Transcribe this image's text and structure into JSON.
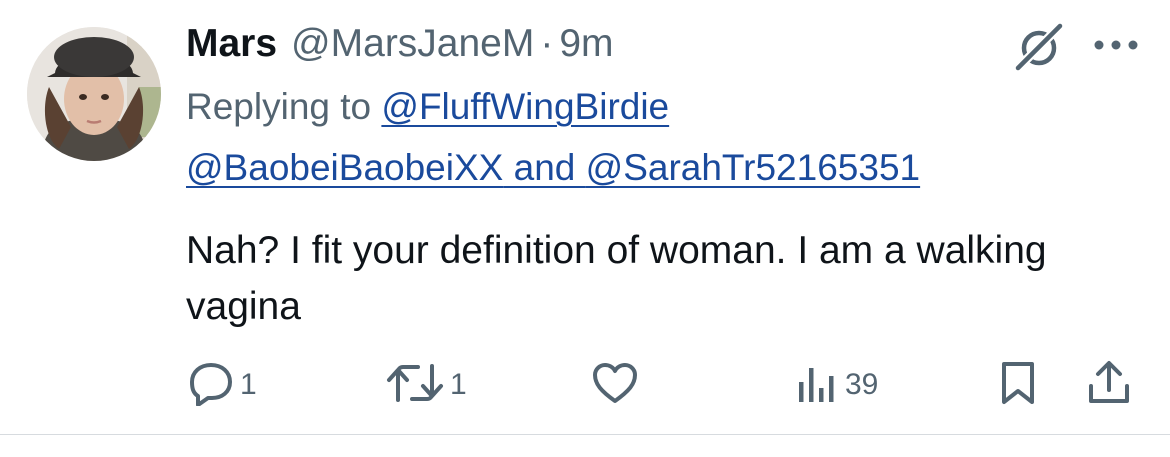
{
  "author": {
    "display_name": "Mars",
    "handle": "@MarsJaneM",
    "separator": "·",
    "time": "9m"
  },
  "reply": {
    "prefix": "Replying to ",
    "mentions": [
      "@FluffWingBirdie",
      "@BaobeiBaobeiXX",
      "@SarahTr52165351"
    ],
    "joiner": " and "
  },
  "tweet": {
    "text": "Nah? I fit your definition of woman. I am a walking vagina"
  },
  "actions": {
    "reply_count": "1",
    "retweet_count": "1",
    "views_count": "39"
  },
  "colors": {
    "text": "#0f1419",
    "muted": "#536471",
    "mention": "#1a4a9c",
    "divider": "#d7dbdf"
  },
  "icons": {
    "header": [
      "grok-icon",
      "more-icon"
    ],
    "actions": [
      "reply-icon",
      "retweet-icon",
      "like-icon",
      "views-icon",
      "bookmark-icon",
      "share-icon"
    ]
  }
}
